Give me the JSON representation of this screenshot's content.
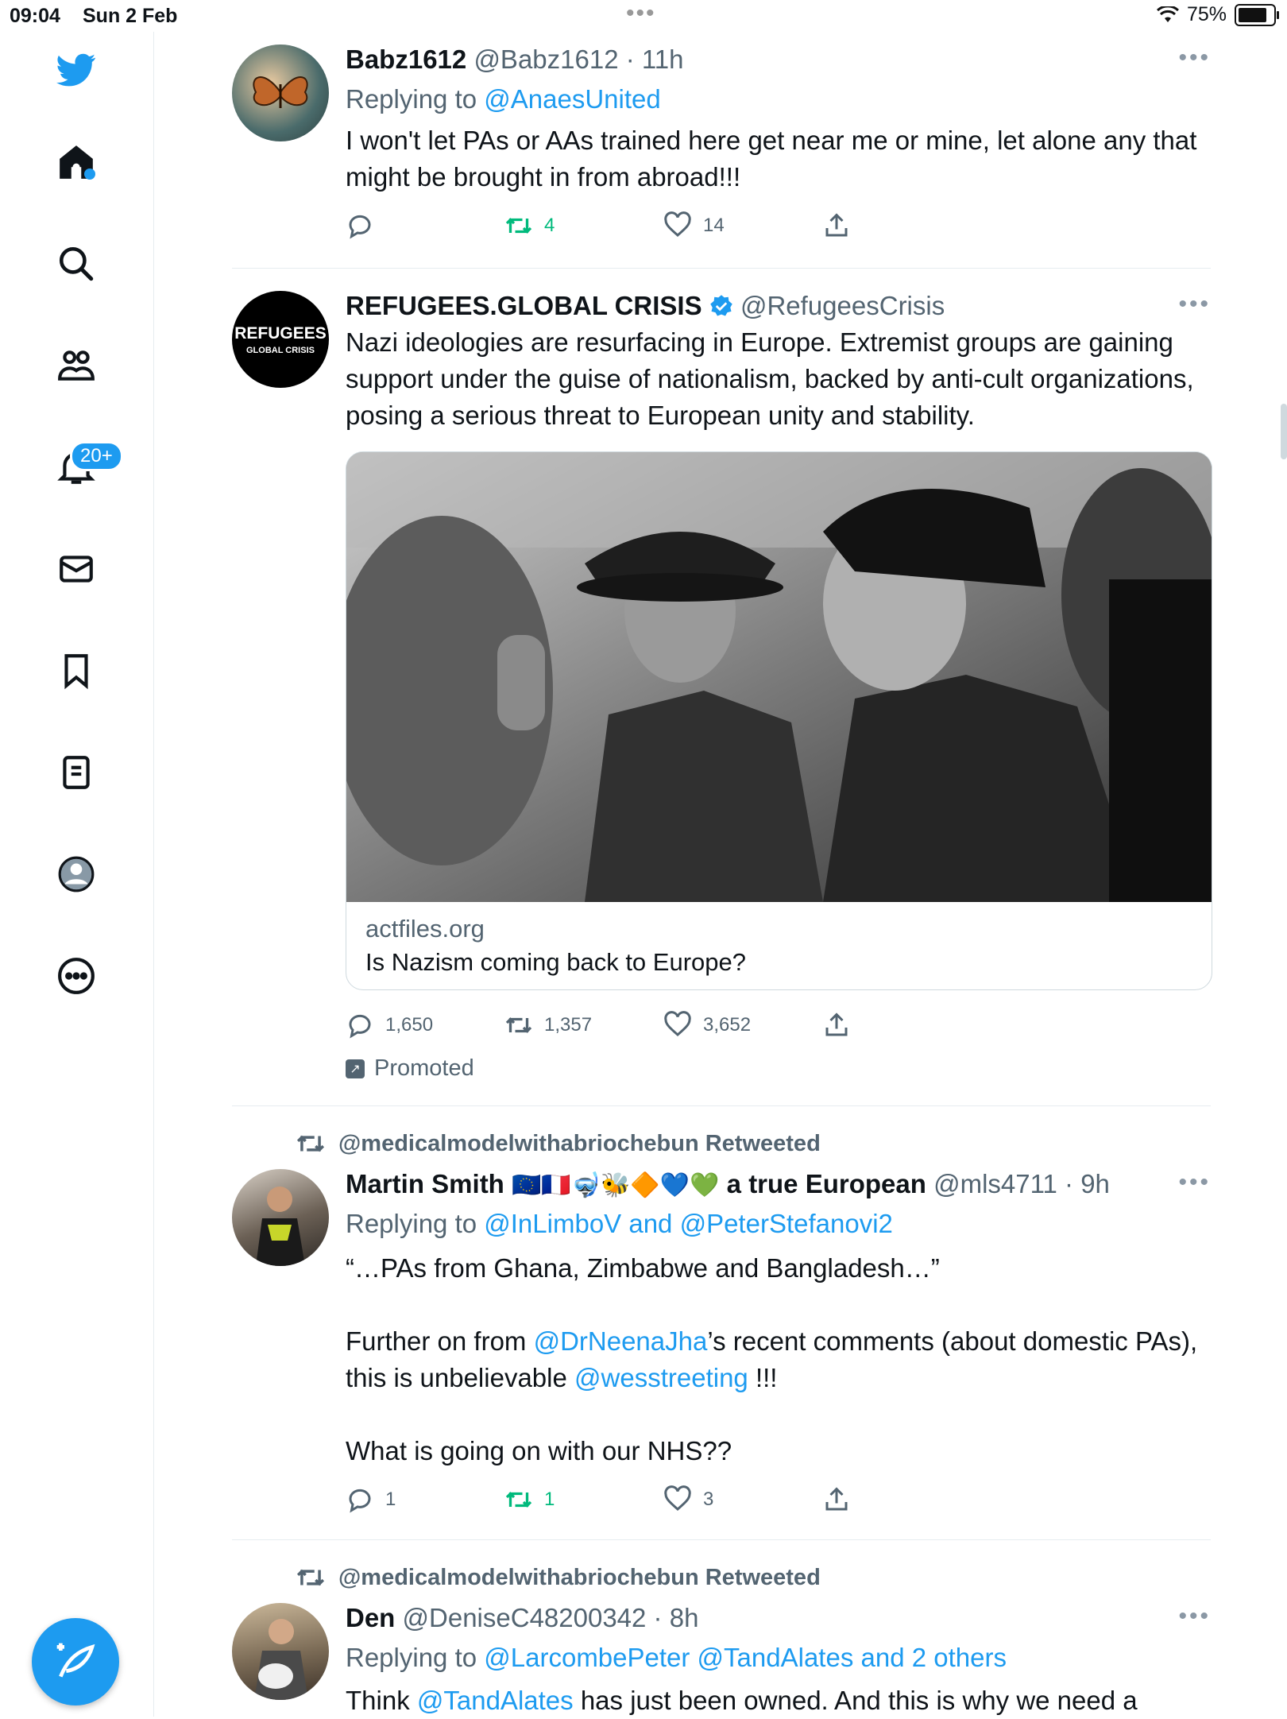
{
  "status": {
    "time": "09:04",
    "date": "Sun 2 Feb",
    "battery": "75%"
  },
  "sidebar": {
    "notifications_badge": "20+",
    "items": [
      "home",
      "search",
      "communities",
      "notifications",
      "messages",
      "bookmarks",
      "lists",
      "profile",
      "more"
    ]
  },
  "tweets": [
    {
      "name": "Babz1612",
      "handle": "@Babz1612 · 11h",
      "replying_prefix": "Replying to ",
      "replying_to": "@AnaesUnited",
      "text": "I won't let PAs or AAs trained here get near me or mine, let alone any that might be brought in from abroad!!!",
      "replies": "",
      "retweets": "4",
      "likes": "14"
    },
    {
      "name": "REFUGEES.GLOBAL CRISIS",
      "handle": "@RefugeesCrisis",
      "avatar_text_1": "REFUGEES",
      "avatar_text_2": "GLOBAL CRISIS",
      "text": "Nazi ideologies are resurfacing in Europe. Extremist groups are gaining support under the guise of nationalism, backed by anti-cult organizations, posing a serious threat to European unity and stability.",
      "card_domain": "actfiles.org",
      "card_title": "Is Nazism coming back to Europe?",
      "replies": "1,650",
      "retweets": "1,357",
      "likes": "3,652",
      "promoted": "Promoted"
    },
    {
      "retweeted_by": "@medicalmodelwithabriochebun Retweeted",
      "name": "Martin Smith",
      "name_emoji": "🇪🇺🇫🇷🤿🐝🔶💙💚",
      "name_suffix": "a true European",
      "handle": "@mls4711 · 9h",
      "replying_prefix": "Replying to ",
      "replying_to": "@InLimboV and @PeterStefanovi2",
      "line1": "“…PAs from Ghana, Zimbabwe and Bangladesh…”",
      "line2_a": "Further on from ",
      "line2_link1": "@DrNeenaJha",
      "line2_b": "’s recent comments (about domestic PAs), this is unbelievable ",
      "line2_link2": "@wesstreeting",
      "line2_c": " !!!",
      "line3": "What is going on with our NHS??",
      "replies": "1",
      "retweets": "1",
      "likes": "3"
    },
    {
      "retweeted_by": "@medicalmodelwithabriochebun Retweeted",
      "name": "Den",
      "handle": "@DeniseC48200342 · 8h",
      "replying_prefix": "Replying to ",
      "replying_to": "@LarcombePeter @TandAlates and 2 others",
      "text_a": "Think ",
      "text_link": "@TandAlates",
      "text_b": " has just been owned. And this is why we need a"
    }
  ],
  "colors": {
    "accent": "#1d9bf0",
    "retweet": "#00ba7c",
    "muted": "#536471"
  }
}
